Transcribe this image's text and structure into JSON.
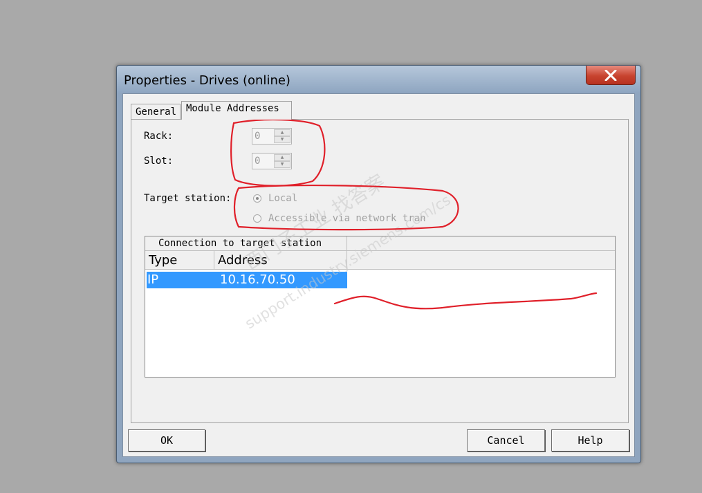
{
  "window": {
    "title": "Properties - Drives (online)"
  },
  "tabs": [
    {
      "label": "General"
    },
    {
      "label": "Module Addresses"
    }
  ],
  "rack": {
    "label": "Rack:",
    "value": "0"
  },
  "slot": {
    "label": "Slot:",
    "value": "0"
  },
  "target_station": {
    "label": "Target station:",
    "options": [
      {
        "label": "Local",
        "selected": true
      },
      {
        "label": "Accessible via network tran",
        "selected": false
      }
    ]
  },
  "connection": {
    "group_header": "Connection to target station",
    "columns": [
      "Type",
      "Address"
    ],
    "rows": [
      {
        "type": "IP",
        "address": "10.16.70.50",
        "selected": true
      }
    ]
  },
  "buttons": {
    "ok": "OK",
    "cancel": "Cancel",
    "help": "Help"
  },
  "watermark": {
    "line1": "西门子工业 找答案",
    "line2": "support.industry.siemens.com/cs"
  },
  "colors": {
    "selection": "#3399ff",
    "annotation": "#e0202a",
    "titlebar": "#8fa5bf",
    "close": "#c7432f"
  }
}
